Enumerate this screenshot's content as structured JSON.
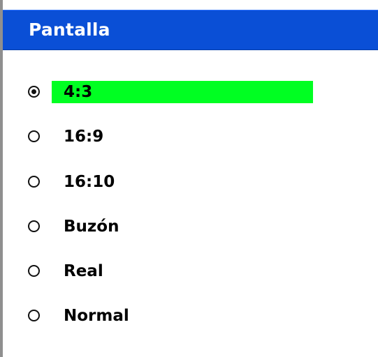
{
  "dialog": {
    "title": "Pantalla",
    "options": [
      {
        "label": "4:3",
        "selected": true
      },
      {
        "label": "16:9",
        "selected": false
      },
      {
        "label": "16:10",
        "selected": false
      },
      {
        "label": "Buzón",
        "selected": false
      },
      {
        "label": "Real",
        "selected": false
      },
      {
        "label": "Normal",
        "selected": false
      }
    ],
    "colors": {
      "title_bar": "#0A4FD6",
      "selection_highlight": "#00FF22",
      "text": "#000000"
    },
    "icons": [
      "radio-selected-icon",
      "radio-unselected-icon"
    ]
  }
}
